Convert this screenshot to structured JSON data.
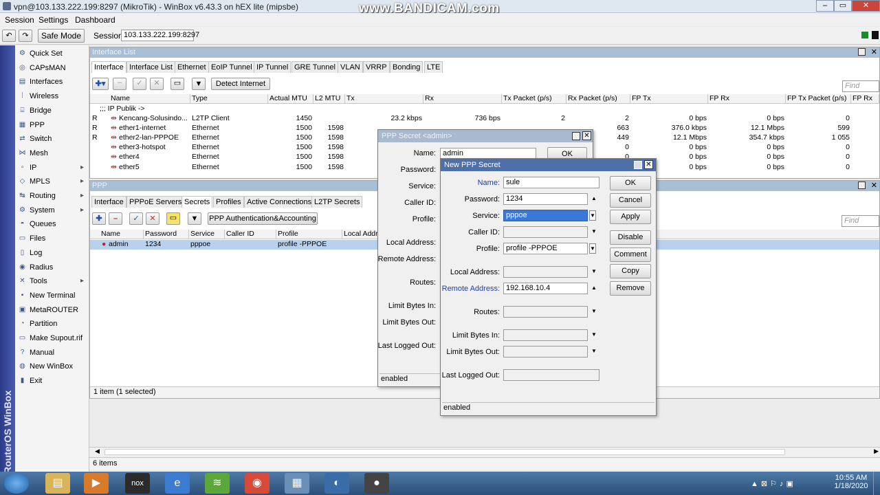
{
  "window": {
    "title": "vpn@103.133.222.199:8297 (MikroTik) - WinBox v6.43.3 on hEX lite (mipsbe)",
    "watermark": "www.BANDICAM.com"
  },
  "menu": [
    "Session",
    "Settings",
    "Dashboard"
  ],
  "toolbar": {
    "safe_mode": "Safe Mode",
    "session_label": "Session:",
    "session_value": "103.133.222.199:8297"
  },
  "brand": "RouterOS WinBox",
  "sidebar": [
    {
      "label": "Quick Set",
      "icon": "quick-set-icon",
      "glyph": "⚙",
      "arrow": false
    },
    {
      "label": "CAPsMAN",
      "icon": "capsman-icon",
      "glyph": "◎",
      "arrow": false
    },
    {
      "label": "Interfaces",
      "icon": "interfaces-icon",
      "glyph": "▤",
      "arrow": false
    },
    {
      "label": "Wireless",
      "icon": "wireless-icon",
      "glyph": "⁞",
      "arrow": false
    },
    {
      "label": "Bridge",
      "icon": "bridge-icon",
      "glyph": "⌸",
      "arrow": false
    },
    {
      "label": "PPP",
      "icon": "ppp-icon",
      "glyph": "▦",
      "arrow": false
    },
    {
      "label": "Switch",
      "icon": "switch-icon",
      "glyph": "⇄",
      "arrow": false
    },
    {
      "label": "Mesh",
      "icon": "mesh-icon",
      "glyph": "⋈",
      "arrow": false
    },
    {
      "label": "IP",
      "icon": "ip-icon",
      "glyph": "▫",
      "arrow": true
    },
    {
      "label": "MPLS",
      "icon": "mpls-icon",
      "glyph": "◇",
      "arrow": true
    },
    {
      "label": "Routing",
      "icon": "routing-icon",
      "glyph": "↹",
      "arrow": true
    },
    {
      "label": "System",
      "icon": "system-icon",
      "glyph": "⚙",
      "arrow": true
    },
    {
      "label": "Queues",
      "icon": "queues-icon",
      "glyph": "◓",
      "arrow": false
    },
    {
      "label": "Files",
      "icon": "files-icon",
      "glyph": "▭",
      "arrow": false
    },
    {
      "label": "Log",
      "icon": "log-icon",
      "glyph": "▯",
      "arrow": false
    },
    {
      "label": "Radius",
      "icon": "radius-icon",
      "glyph": "◉",
      "arrow": false
    },
    {
      "label": "Tools",
      "icon": "tools-icon",
      "glyph": "✕",
      "arrow": true
    },
    {
      "label": "New Terminal",
      "icon": "terminal-icon",
      "glyph": "▪",
      "arrow": false
    },
    {
      "label": "MetaROUTER",
      "icon": "metarouter-icon",
      "glyph": "▣",
      "arrow": false
    },
    {
      "label": "Partition",
      "icon": "partition-icon",
      "glyph": "◔",
      "arrow": false
    },
    {
      "label": "Make Supout.rif",
      "icon": "supout-icon",
      "glyph": "▭",
      "arrow": false
    },
    {
      "label": "Manual",
      "icon": "manual-icon",
      "glyph": "?",
      "arrow": false
    },
    {
      "label": "New WinBox",
      "icon": "winbox-icon",
      "glyph": "◍",
      "arrow": false
    },
    {
      "label": "Exit",
      "icon": "exit-icon",
      "glyph": "▮",
      "arrow": false
    }
  ],
  "interface_list": {
    "title": "Interface List",
    "tabs": [
      "Interface",
      "Interface List",
      "Ethernet",
      "EoIP Tunnel",
      "IP Tunnel",
      "GRE Tunnel",
      "VLAN",
      "VRRP",
      "Bonding",
      "LTE"
    ],
    "detect_btn": "Detect Internet",
    "find_placeholder": "Find",
    "columns": [
      "Name",
      "Type",
      "Actual MTU",
      "L2 MTU",
      "Tx",
      "Rx",
      "Tx Packet (p/s)",
      "Rx Packet (p/s)",
      "FP Tx",
      "FP Rx",
      "FP Tx Packet (p/s)",
      "FP Rx"
    ],
    "comment": ";;; IP Publik ->",
    "rows": [
      {
        "flag": "",
        "name": "Kencang-Solusindo...",
        "type": "L2TP Client",
        "mtu": "1450",
        "l2mtu": "",
        "tx": "23.2 kbps",
        "rx": "736 bps",
        "txp": "2",
        "rxp": "2",
        "fptx": "0 bps",
        "fprx": "0 bps",
        "fptxp": "0"
      },
      {
        "flag": "R",
        "name": "ether1-internet",
        "type": "Ethernet",
        "mtu": "1500",
        "l2mtu": "1598",
        "tx": "",
        "rx": "",
        "txp": "",
        "rxp": "663",
        "fptx": "376.0 kbps",
        "fprx": "12.1 Mbps",
        "fptxp": "599"
      },
      {
        "flag": "R",
        "name": "ether2-lan-PPPOE",
        "type": "Ethernet",
        "mtu": "1500",
        "l2mtu": "1598",
        "tx": "",
        "rx": "",
        "txp": "",
        "rxp": "449",
        "fptx": "12.1 Mbps",
        "fprx": "354.7 kbps",
        "fptxp": "1 055"
      },
      {
        "flag": "",
        "name": "ether3-hotspot",
        "type": "Ethernet",
        "mtu": "1500",
        "l2mtu": "1598",
        "tx": "",
        "rx": "",
        "txp": "",
        "rxp": "0",
        "fptx": "0 bps",
        "fprx": "0 bps",
        "fptxp": "0"
      },
      {
        "flag": "",
        "name": "ether4",
        "type": "Ethernet",
        "mtu": "1500",
        "l2mtu": "1598",
        "tx": "",
        "rx": "",
        "txp": "",
        "rxp": "0",
        "fptx": "0 bps",
        "fprx": "0 bps",
        "fptxp": "0"
      },
      {
        "flag": "",
        "name": "ether5",
        "type": "Ethernet",
        "mtu": "1500",
        "l2mtu": "1598",
        "tx": "",
        "rx": "",
        "txp": "",
        "rxp": "0",
        "fptx": "0 bps",
        "fprx": "0 bps",
        "fptxp": "0"
      }
    ],
    "first_row_flag": "R",
    "status": "6 items"
  },
  "ppp": {
    "title": "PPP",
    "tabs": [
      "Interface",
      "PPPoE Servers",
      "Secrets",
      "Profiles",
      "Active Connections",
      "L2TP Secrets"
    ],
    "auth_btn": "PPP Authentication&Accounting",
    "find_placeholder": "Find",
    "columns": [
      "Name",
      "Password",
      "Service",
      "Caller ID",
      "Profile",
      "Local Addr"
    ],
    "rows": [
      {
        "name": "admin",
        "password": "1234",
        "service": "pppoe",
        "caller": "",
        "profile": "profile -PPPOE"
      }
    ],
    "status": "1 item (1 selected)"
  },
  "secret_admin": {
    "title": "PPP Secret <admin>",
    "name": "admin",
    "ok": "OK",
    "labels": [
      "Name:",
      "Password:",
      "Service:",
      "Caller ID:",
      "Profile:",
      "Local Address:",
      "Remote Address:",
      "Routes:",
      "Limit Bytes In:",
      "Limit Bytes Out:",
      "Last Logged Out:"
    ],
    "status": "enabled"
  },
  "new_secret": {
    "title": "New PPP Secret",
    "labels": {
      "name": "Name:",
      "password": "Password:",
      "service": "Service:",
      "caller": "Caller ID:",
      "profile": "Profile:",
      "local": "Local Address:",
      "remote": "Remote Address:",
      "routes": "Routes:",
      "lbin": "Limit Bytes In:",
      "lbout": "Limit Bytes Out:",
      "last": "Last Logged Out:"
    },
    "values": {
      "name": "sule",
      "password": "1234",
      "service": "pppoe",
      "caller": "",
      "profile": "profile -PPPOE",
      "local": "",
      "remote": "192.168.10.4",
      "routes": "",
      "lbin": "",
      "lbout": "",
      "last": ""
    },
    "buttons": [
      "OK",
      "Cancel",
      "Apply",
      "Disable",
      "Comment",
      "Copy",
      "Remove"
    ],
    "status": "enabled"
  },
  "clock": {
    "time": "10:55 AM",
    "date": "1/18/2020"
  }
}
